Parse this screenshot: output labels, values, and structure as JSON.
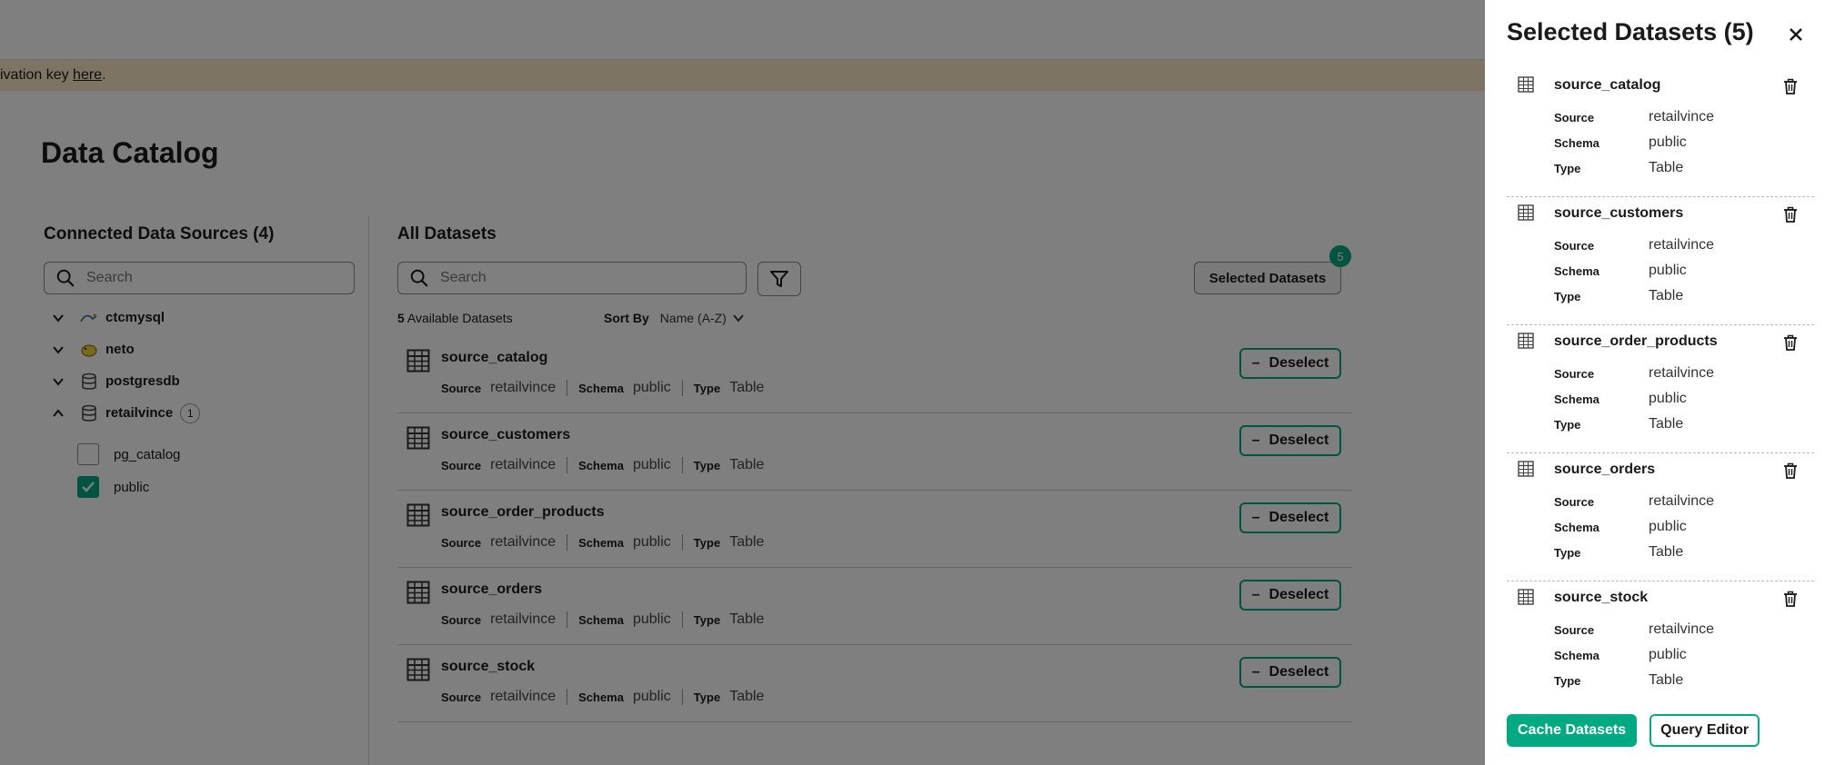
{
  "banner": {
    "text": "ivation key ",
    "link": "here",
    "end": "."
  },
  "page_title": "Data Catalog",
  "sources": {
    "title": "Connected Data Sources (4)",
    "search_placeholder": "Search",
    "items": [
      {
        "label": "ctcmysql",
        "icon": "mysql-icon",
        "expanded": false
      },
      {
        "label": "neto",
        "icon": "hadoop-icon",
        "expanded": false
      },
      {
        "label": "postgresdb",
        "icon": "database-icon",
        "expanded": false
      },
      {
        "label": "retailvince",
        "icon": "database-icon",
        "expanded": true,
        "count": "1"
      }
    ],
    "schemas": [
      {
        "label": "pg_catalog",
        "checked": false
      },
      {
        "label": "public",
        "checked": true
      }
    ]
  },
  "datasets": {
    "title": "All Datasets",
    "search_placeholder": "Search",
    "selected_button": "Selected Datasets",
    "selected_count": "5",
    "available_count": "5",
    "available_label": "Available Datasets",
    "sort_label": "Sort By",
    "sort_value": "Name (A-Z)",
    "deselect_label": "Deselect",
    "labels": {
      "source": "Source",
      "schema": "Schema",
      "type": "Type"
    },
    "rows": [
      {
        "name": "source_catalog",
        "source": "retailvince",
        "schema": "public",
        "type": "Table"
      },
      {
        "name": "source_customers",
        "source": "retailvince",
        "schema": "public",
        "type": "Table"
      },
      {
        "name": "source_order_products",
        "source": "retailvince",
        "schema": "public",
        "type": "Table"
      },
      {
        "name": "source_orders",
        "source": "retailvince",
        "schema": "public",
        "type": "Table"
      },
      {
        "name": "source_stock",
        "source": "retailvince",
        "schema": "public",
        "type": "Table"
      }
    ]
  },
  "drawer": {
    "title": "Selected Datasets (5)",
    "labels": {
      "source": "Source",
      "schema": "Schema",
      "type": "Type"
    },
    "items": [
      {
        "name": "source_catalog",
        "source": "retailvince",
        "schema": "public",
        "type": "Table"
      },
      {
        "name": "source_customers",
        "source": "retailvince",
        "schema": "public",
        "type": "Table"
      },
      {
        "name": "source_order_products",
        "source": "retailvince",
        "schema": "public",
        "type": "Table"
      },
      {
        "name": "source_orders",
        "source": "retailvince",
        "schema": "public",
        "type": "Table"
      },
      {
        "name": "source_stock",
        "source": "retailvince",
        "schema": "public",
        "type": "Table"
      }
    ],
    "cache_button": "Cache Datasets",
    "query_button": "Query Editor"
  },
  "colors": {
    "accent": "#01a982",
    "banner": "#fce9c8",
    "overlay": "rgba(0,0,0,0.5)"
  }
}
